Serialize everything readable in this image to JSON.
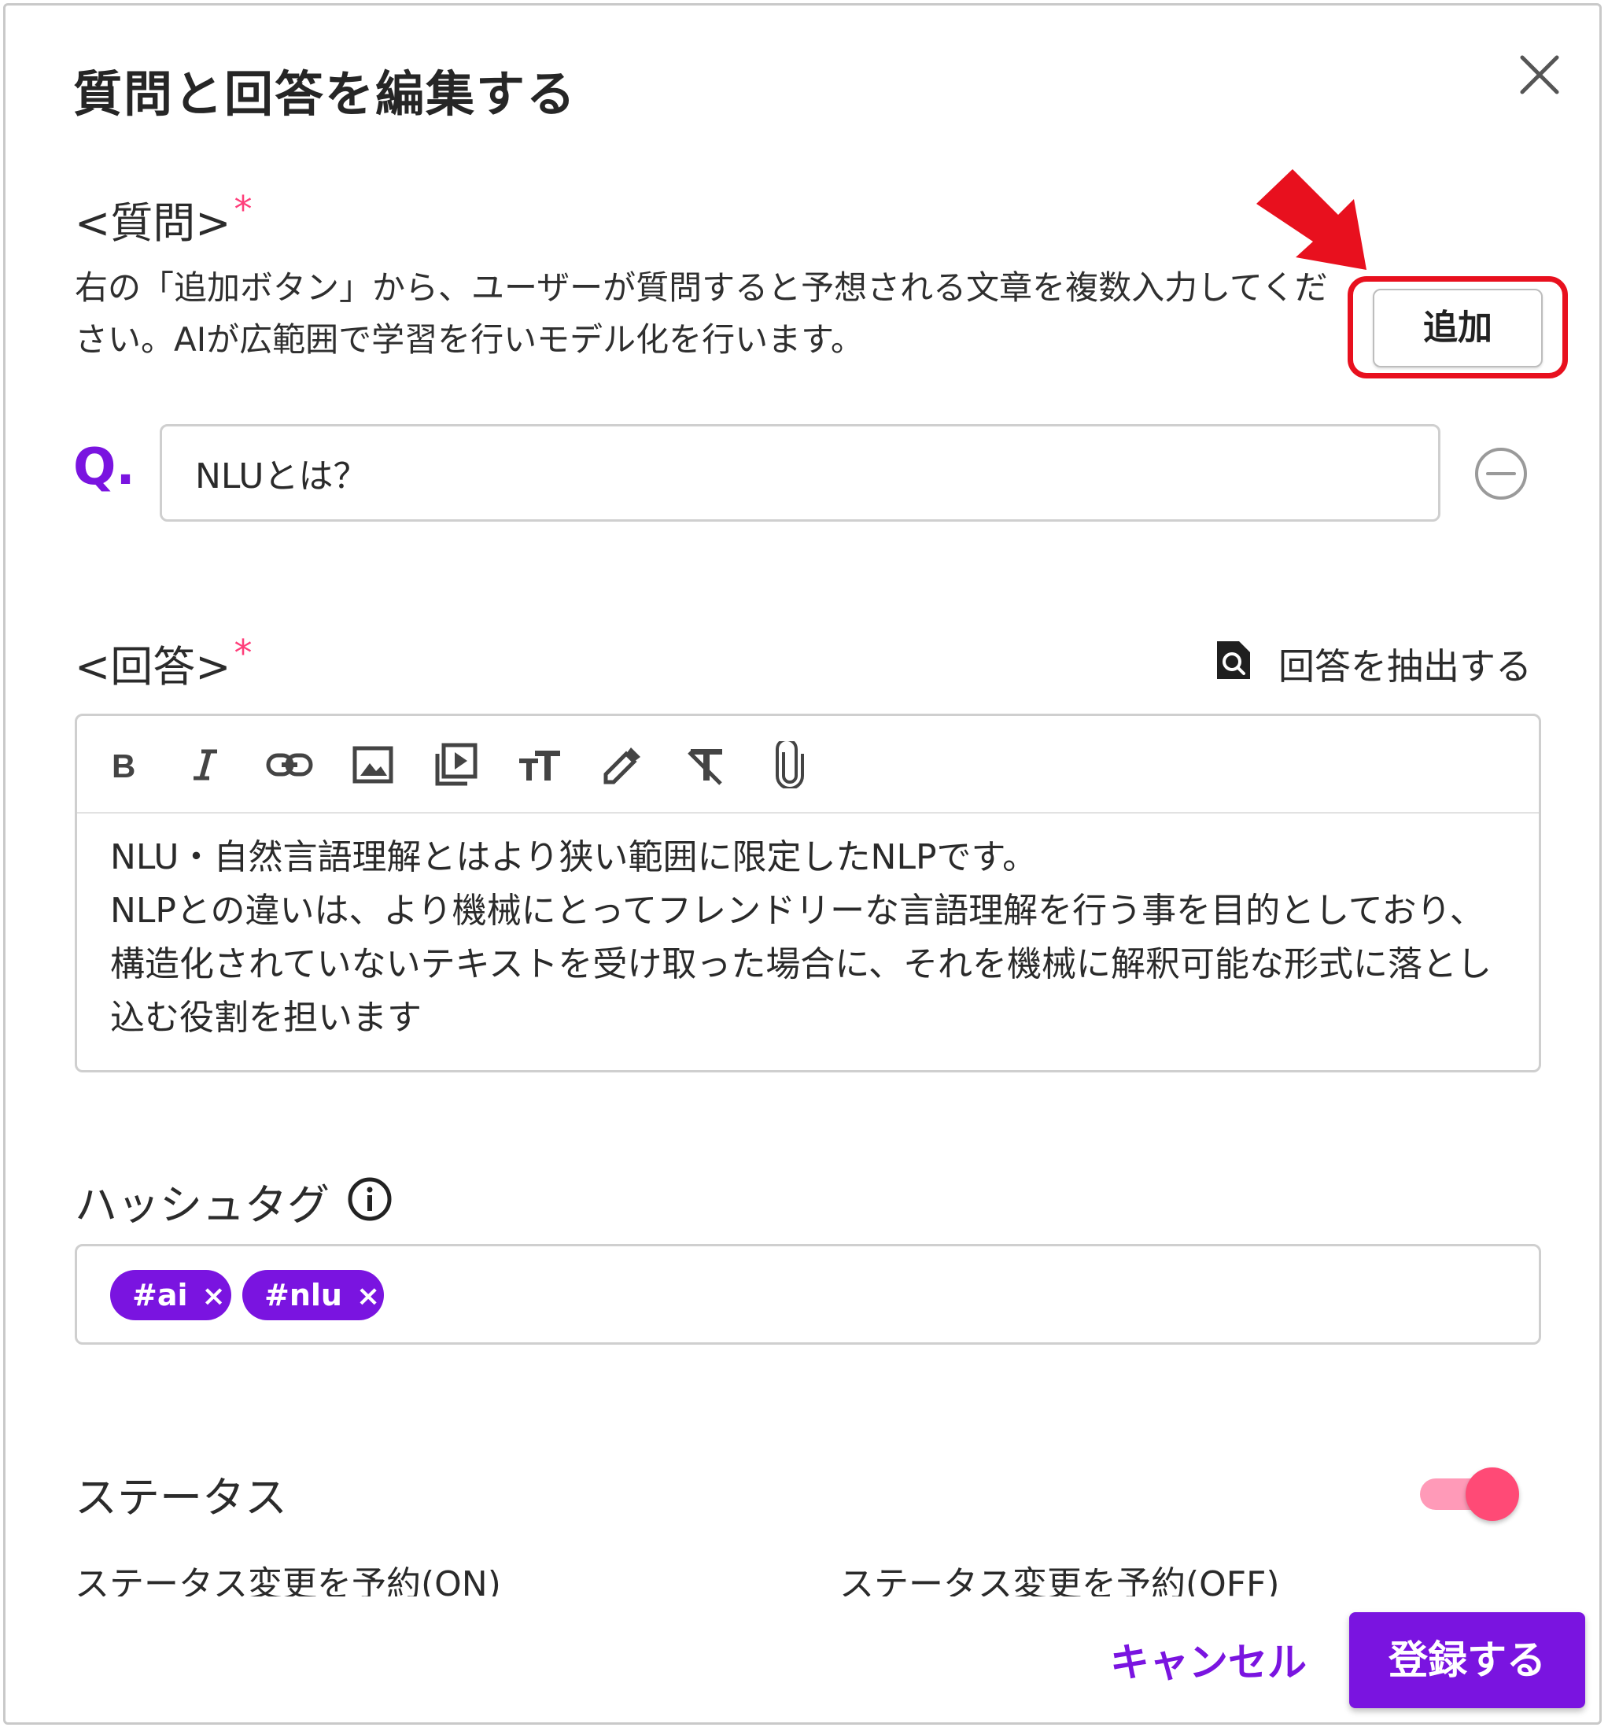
{
  "dialog": {
    "title": "質問と回答を編集する"
  },
  "question": {
    "label": "<質問>",
    "required_mark": "*",
    "description": "右の「追加ボタン」から、ユーザーが質問すると予想される文章を複数入力してください。AIが広範囲で学習を行いモデル化を行います。",
    "add_button": "追加",
    "prefix": "Q.",
    "input_value": "NLUとは？"
  },
  "answer": {
    "label": "<回答>",
    "required_mark": "*",
    "extract_label": "回答を抽出する",
    "toolbar": [
      "bold-icon",
      "italic-icon",
      "link-icon",
      "image-icon",
      "video-icon",
      "text-size-icon",
      "color-picker-icon",
      "clear-format-icon",
      "attachment-icon"
    ],
    "text": "NLU・自然言語理解とはより狭い範囲に限定したNLPです。\nNLPとの違いは、より機械にとってフレンドリーな言語理解を行う事を目的としており、構造化されていないテキストを受け取った場合に、それを機械に解釈可能な形式に落とし込む役割を担います"
  },
  "hashtags": {
    "label": "ハッシュタグ",
    "tags": [
      "#ai",
      "#nlu"
    ],
    "remove_glyph": "×"
  },
  "status": {
    "label": "ステータス",
    "enabled": true,
    "schedule_on": "ステータス変更を予約(ON)",
    "schedule_off": "ステータス変更を予約(OFF)"
  },
  "footer": {
    "cancel": "キャンセル",
    "submit": "登録する"
  },
  "colors": {
    "accent": "#7a14e0",
    "required": "#ff3e7a",
    "toggle_on": "#ff4a76",
    "highlight": "#e8101e"
  }
}
